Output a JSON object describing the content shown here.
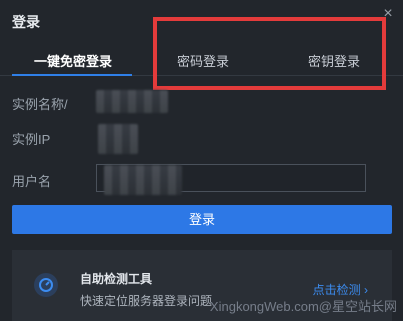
{
  "dialog": {
    "title": "登录",
    "close_label": "×"
  },
  "tabs": [
    {
      "label": "一键免密登录",
      "active": true
    },
    {
      "label": "密码登录",
      "active": false
    },
    {
      "label": "密钥登录",
      "active": false
    }
  ],
  "form": {
    "instance_name_label": "实例名称/",
    "instance_ip_label": "实例IP",
    "username_label": "用户名",
    "login_button": "登录"
  },
  "tool": {
    "title": "自助检测工具",
    "description": "快速定位服务器登录问题",
    "link": "点击检测 ›",
    "icon": "gauge-icon"
  },
  "watermark": "XingkongWeb.com@星空站长网",
  "colors": {
    "accent": "#2d78e6",
    "highlight_box": "#e43b3b",
    "background": "#22262c"
  }
}
